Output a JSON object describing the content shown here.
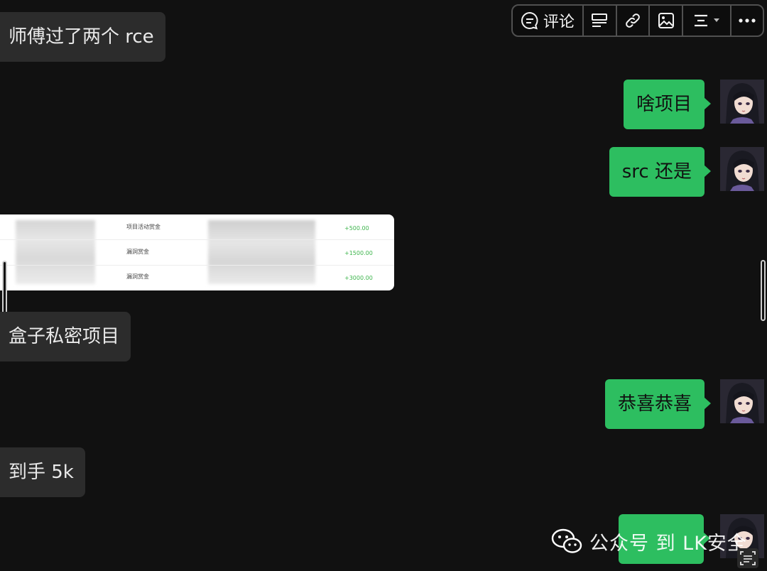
{
  "toolbar": {
    "comment_label": "评论",
    "buttons": [
      "comment-button",
      "card-button",
      "link-button",
      "image-button",
      "align-button",
      "more-button"
    ]
  },
  "messages": {
    "in_1": "师傅过了两个 rce",
    "out_1": "啥项目",
    "out_2": "src 还是",
    "in_2": "盒子私密项目",
    "out_3": "恭喜恭喜",
    "in_3": "到手 5k"
  },
  "shared_image": {
    "rows": [
      {
        "category": "项目活动赏金",
        "amount": "+500.00"
      },
      {
        "category": "漏洞赏金",
        "amount": "+1500.00"
      },
      {
        "category": "漏洞赏金",
        "amount": "+3000.00"
      }
    ]
  },
  "watermark": {
    "text": "公众号 到 LK安全"
  },
  "colors": {
    "background": "#111111",
    "incoming_bubble": "#2c2c2c",
    "outgoing_bubble": "#2dbe60",
    "amount_green": "#3cb44b"
  }
}
